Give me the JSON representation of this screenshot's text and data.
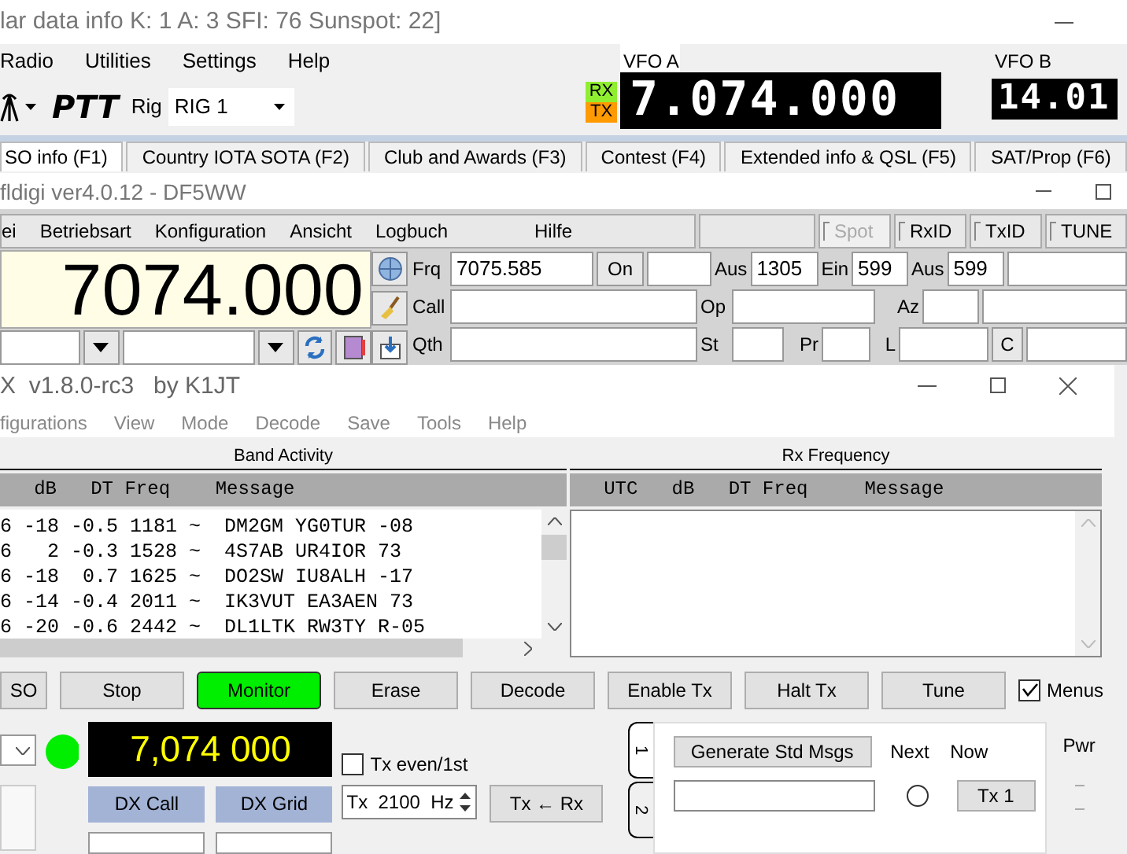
{
  "logger": {
    "title": "lar data info K: 1 A: 3 SFI: 76 Sunspot: 22]",
    "menu": [
      "Radio",
      "Utilities",
      "Settings",
      "Help"
    ],
    "ptt": "PTT",
    "rig_label": "Rig",
    "rig_value": "RIG 1",
    "rx": "RX",
    "tx": "TX",
    "vfo_a": {
      "label": "VFO A",
      "value": "7.074.000"
    },
    "vfo_b": {
      "label": "VFO B",
      "value": "14.01"
    },
    "tabs": [
      {
        "label": "SO info (F1)",
        "selected": true
      },
      {
        "label": "Country IOTA SOTA (F2)",
        "selected": false
      },
      {
        "label": "Club and Awards (F3)",
        "selected": false
      },
      {
        "label": "Contest (F4)",
        "selected": false
      },
      {
        "label": "Extended info & QSL (F5)",
        "selected": false
      },
      {
        "label": "SAT/Prop (F6)",
        "selected": false
      }
    ]
  },
  "fldigi": {
    "title": "fldigi ver4.0.12 - DF5WW",
    "menu": [
      "ei",
      "Betriebsart",
      "Konfiguration",
      "Ansicht",
      "Logbuch",
      "Hilfe"
    ],
    "toggles": [
      {
        "label": "Spot",
        "checked": false,
        "disabled": true
      },
      {
        "label": "RxID",
        "checked": false,
        "disabled": false
      },
      {
        "label": "TxID",
        "checked": false,
        "disabled": false
      },
      {
        "label": "TUNE",
        "checked": false,
        "disabled": false
      }
    ],
    "frequency": "7074.000",
    "frq": {
      "label": "Frq",
      "value": "7075.585"
    },
    "on_button": "On",
    "aus_1": {
      "label": "Aus",
      "value": "1305"
    },
    "ein": {
      "label": "Ein",
      "value": "599"
    },
    "aus_2": {
      "label": "Aus",
      "value": "599"
    },
    "call_label": "Call",
    "op_label": "Op",
    "az_label": "Az",
    "qth_label": "Qth",
    "st_label": "St",
    "pr_label": "Pr",
    "l_label": "L",
    "c_button": "C"
  },
  "wsjt": {
    "title": "X  v1.8.0-rc3   by K1JT",
    "menu": [
      "figurations",
      "View",
      "Mode",
      "Decode",
      "Save",
      "Tools",
      "Help"
    ],
    "band_activity": {
      "title": "Band Activity",
      "header": "   dB   DT Freq    Message",
      "rows": [
        "6 -18 -0.5 1181 ~  DM2GM YG0TUR -08",
        "6   2 -0.3 1528 ~  4S7AB UR4IOR 73",
        "6 -18  0.7 1625 ~  DO2SW IU8ALH -17",
        "6 -14 -0.4 2011 ~  IK3VUT EA3AEN 73",
        "6 -20 -0.6 2442 ~  DL1LTK RW3TY R-05"
      ]
    },
    "rx_frequency": {
      "title": "Rx Frequency",
      "header": "   UTC   dB   DT Freq     Message"
    },
    "buttons": [
      {
        "label": "SO",
        "on": false
      },
      {
        "label": "Stop",
        "on": false
      },
      {
        "label": "Monitor",
        "on": true
      },
      {
        "label": "Erase",
        "on": false
      },
      {
        "label": "Decode",
        "on": false
      },
      {
        "label": "Enable Tx",
        "on": false
      },
      {
        "label": "Halt Tx",
        "on": false
      },
      {
        "label": "Tune",
        "on": false
      }
    ],
    "menus_checkbox": {
      "label": "Menus",
      "checked": true
    },
    "frequency": "7,074 000",
    "tx_even": {
      "label": "Tx even/1st",
      "checked": false
    },
    "dx_call": "DX Call",
    "dx_grid": "DX Grid",
    "tx_freq": "Tx  2100  Hz",
    "tx_from_rx": "Tx ← Rx",
    "msg_tabs": [
      {
        "label": "1",
        "selected": true
      },
      {
        "label": "2",
        "selected": false
      }
    ],
    "generate": "Generate Std Msgs",
    "next": "Next",
    "now": "Now",
    "tx1": {
      "label": "Tx 1",
      "selected": false
    },
    "pwr": "Pwr"
  }
}
